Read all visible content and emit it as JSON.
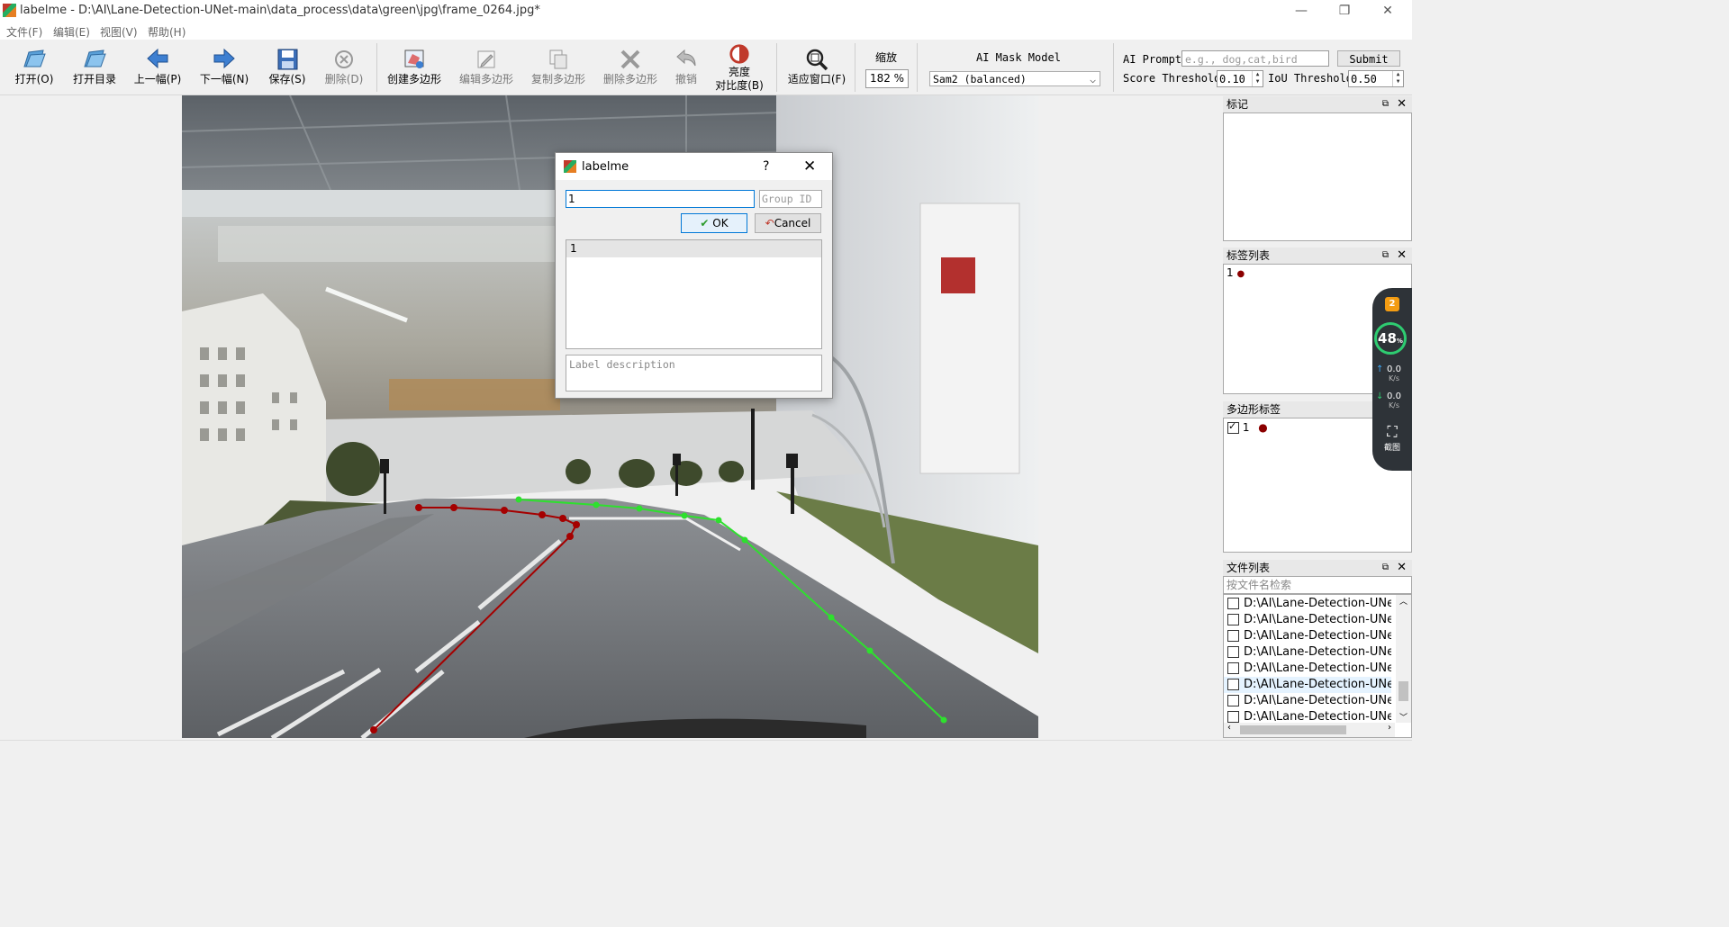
{
  "window": {
    "title": "labelme - D:\\AI\\Lane-Detection-UNet-main\\data_process\\data\\green\\jpg\\frame_0264.jpg*",
    "minimize": "—",
    "restore": "❐",
    "close": "✕"
  },
  "menu": [
    "文件(F)",
    "编辑(E)",
    "视图(V)",
    "帮助(H)"
  ],
  "toolbar": {
    "open": "打开(O)",
    "open_dir": "打开目录",
    "prev": "上一幅(P)",
    "next": "下一幅(N)",
    "save": "保存(S)",
    "delete": "删除(D)",
    "create_polygon": "创建多边形",
    "edit_polygon": "编辑多边形",
    "copy_polygon": "复制多边形",
    "delete_polygon": "删除多边形",
    "undo": "撤销",
    "brightness_line1": "亮度",
    "brightness_line2": "对比度(B)",
    "fit_window": "适应窗口(F)",
    "zoom_label": "缩放",
    "zoom_value": "182 %",
    "ai_mask_label": "AI Mask Model",
    "ai_mask_value": "Sam2 (balanced)",
    "ai_prompt_label": "AI Prompt",
    "ai_prompt_placeholder": "e.g., dog,cat,bird",
    "submit": "Submit",
    "score_label": "Score Threshold",
    "score_value": "0.10",
    "iou_label": "IoU Threshold",
    "iou_value": "0.50"
  },
  "dialog": {
    "title": "labelme",
    "help": "?",
    "close": "✕",
    "label_value": "1",
    "group_id_placeholder": "Group ID",
    "ok": "OK",
    "cancel": "Cancel",
    "list_items": [
      "1"
    ],
    "description_placeholder": "Label description"
  },
  "docks": {
    "flags": {
      "title": "标记"
    },
    "label_list": {
      "title": "标签列表",
      "items": [
        {
          "label": "1",
          "color": "#8b0000"
        }
      ]
    },
    "polygon_labels": {
      "title": "多边形标签",
      "items": [
        {
          "label": "1",
          "color": "#8b0000",
          "checked": true
        }
      ]
    },
    "file_list": {
      "title": "文件列表",
      "search_placeholder": "按文件名检索",
      "items": [
        "D:\\AI\\Lane-Detection-UNet-main",
        "D:\\AI\\Lane-Detection-UNet-main",
        "D:\\AI\\Lane-Detection-UNet-main",
        "D:\\AI\\Lane-Detection-UNet-main",
        "D:\\AI\\Lane-Detection-UNet-main",
        "D:\\AI\\Lane-Detection-UNet-main",
        "D:\\AI\\Lane-Detection-UNet-main",
        "D:\\AI\\Lane-Detection-UNet-main"
      ]
    }
  },
  "widget": {
    "badge": "2",
    "percent": "48",
    "percent_unit": "%",
    "up_speed": "0.0",
    "up_unit": "K/s",
    "down_speed": "0.0",
    "down_unit": "K/s",
    "screenshot_label": "截图"
  },
  "colors": {
    "left_lane": "#a50000",
    "right_lane": "#2ee02e",
    "accent": "#0078d7"
  }
}
